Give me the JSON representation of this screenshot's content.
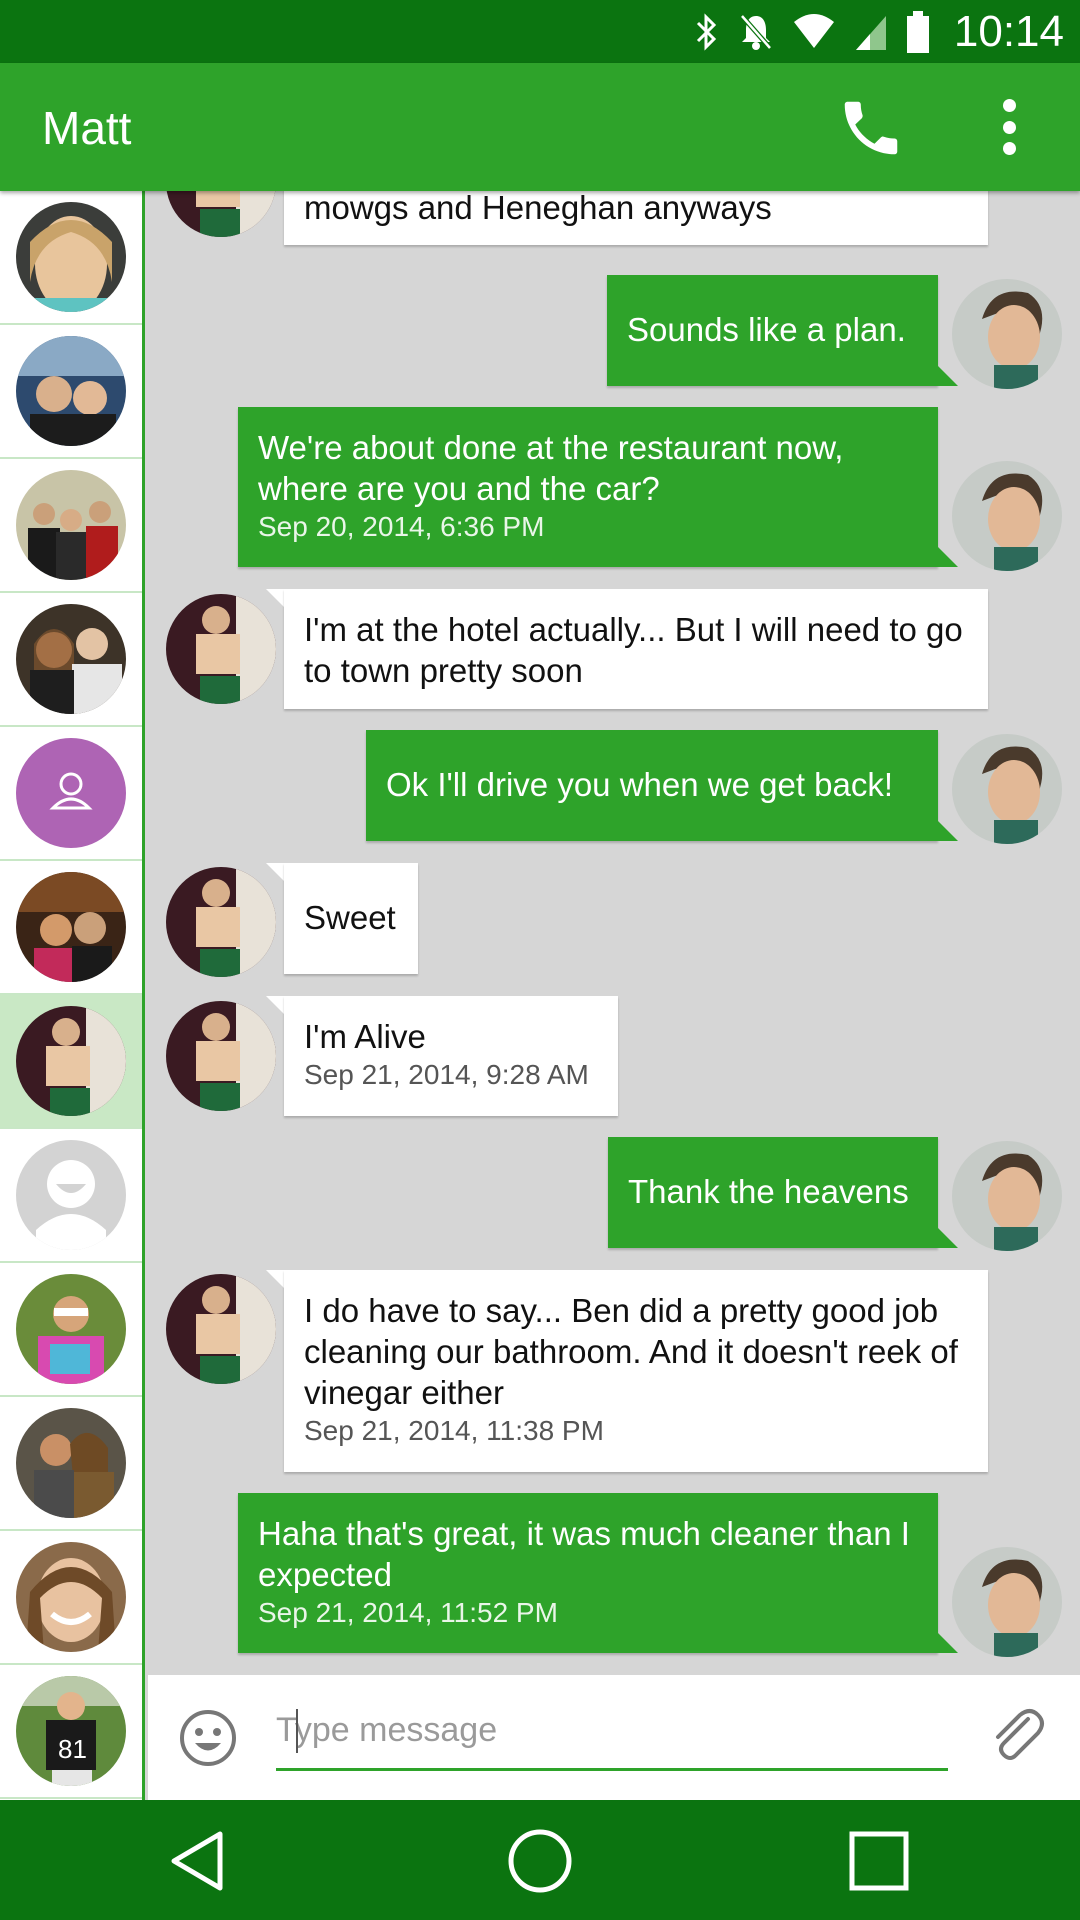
{
  "status_bar": {
    "time": "10:14",
    "icons": [
      "bluetooth-icon",
      "notifications-off-icon",
      "wifi-icon",
      "signal-icon",
      "battery-icon"
    ]
  },
  "app_bar": {
    "title": "Matt",
    "actions": [
      "phone-icon",
      "more-vert-icon"
    ],
    "colors": {
      "primary": "#2ea32a",
      "dark": "#0b7410"
    }
  },
  "contacts": [
    {
      "name": "contact-1",
      "kind": "photo",
      "selected": false
    },
    {
      "name": "contact-2",
      "kind": "photo",
      "selected": false
    },
    {
      "name": "contact-3",
      "kind": "photo",
      "selected": false
    },
    {
      "name": "contact-4",
      "kind": "photo",
      "selected": false
    },
    {
      "name": "contact-5",
      "kind": "placeholder-purple",
      "selected": false
    },
    {
      "name": "contact-6",
      "kind": "photo",
      "selected": false
    },
    {
      "name": "contact-7",
      "kind": "photo",
      "selected": true
    },
    {
      "name": "contact-8",
      "kind": "placeholder-grey",
      "selected": false
    },
    {
      "name": "contact-9",
      "kind": "photo",
      "selected": false
    },
    {
      "name": "contact-10",
      "kind": "photo",
      "selected": false
    },
    {
      "name": "contact-11",
      "kind": "photo",
      "selected": false
    },
    {
      "name": "contact-12",
      "kind": "photo",
      "selected": false
    }
  ],
  "messages": [
    {
      "dir": "in",
      "text": "mowgs and Heneghan anyways",
      "stamp": ""
    },
    {
      "dir": "out",
      "text": "Sounds like a plan.",
      "stamp": ""
    },
    {
      "dir": "out",
      "text": "We're about done at the restaurant now, where are you and the car?",
      "stamp": "Sep 20, 2014, 6:36 PM"
    },
    {
      "dir": "in",
      "text": "I'm at the hotel actually... But I will need to go to town pretty soon",
      "stamp": ""
    },
    {
      "dir": "out",
      "text": "Ok I'll drive you when we get back!",
      "stamp": ""
    },
    {
      "dir": "in",
      "text": "Sweet",
      "stamp": ""
    },
    {
      "dir": "in",
      "text": "I'm Alive",
      "stamp": "Sep 21, 2014, 9:28 AM"
    },
    {
      "dir": "out",
      "text": "Thank the heavens",
      "stamp": ""
    },
    {
      "dir": "in",
      "text": "I do have to say... Ben did a pretty good job cleaning our bathroom. And it doesn't reek of vinegar either",
      "stamp": "Sep 21, 2014, 11:38 PM"
    },
    {
      "dir": "out",
      "text": "Haha that's great, it was much cleaner than I expected",
      "stamp": "Sep 21, 2014, 11:52 PM"
    }
  ],
  "composer": {
    "placeholder": "Type message",
    "value": "",
    "icons": [
      "emoji-icon",
      "attach-icon"
    ]
  },
  "nav_bar": {
    "icons": [
      "back-icon",
      "home-icon",
      "recents-icon"
    ]
  }
}
